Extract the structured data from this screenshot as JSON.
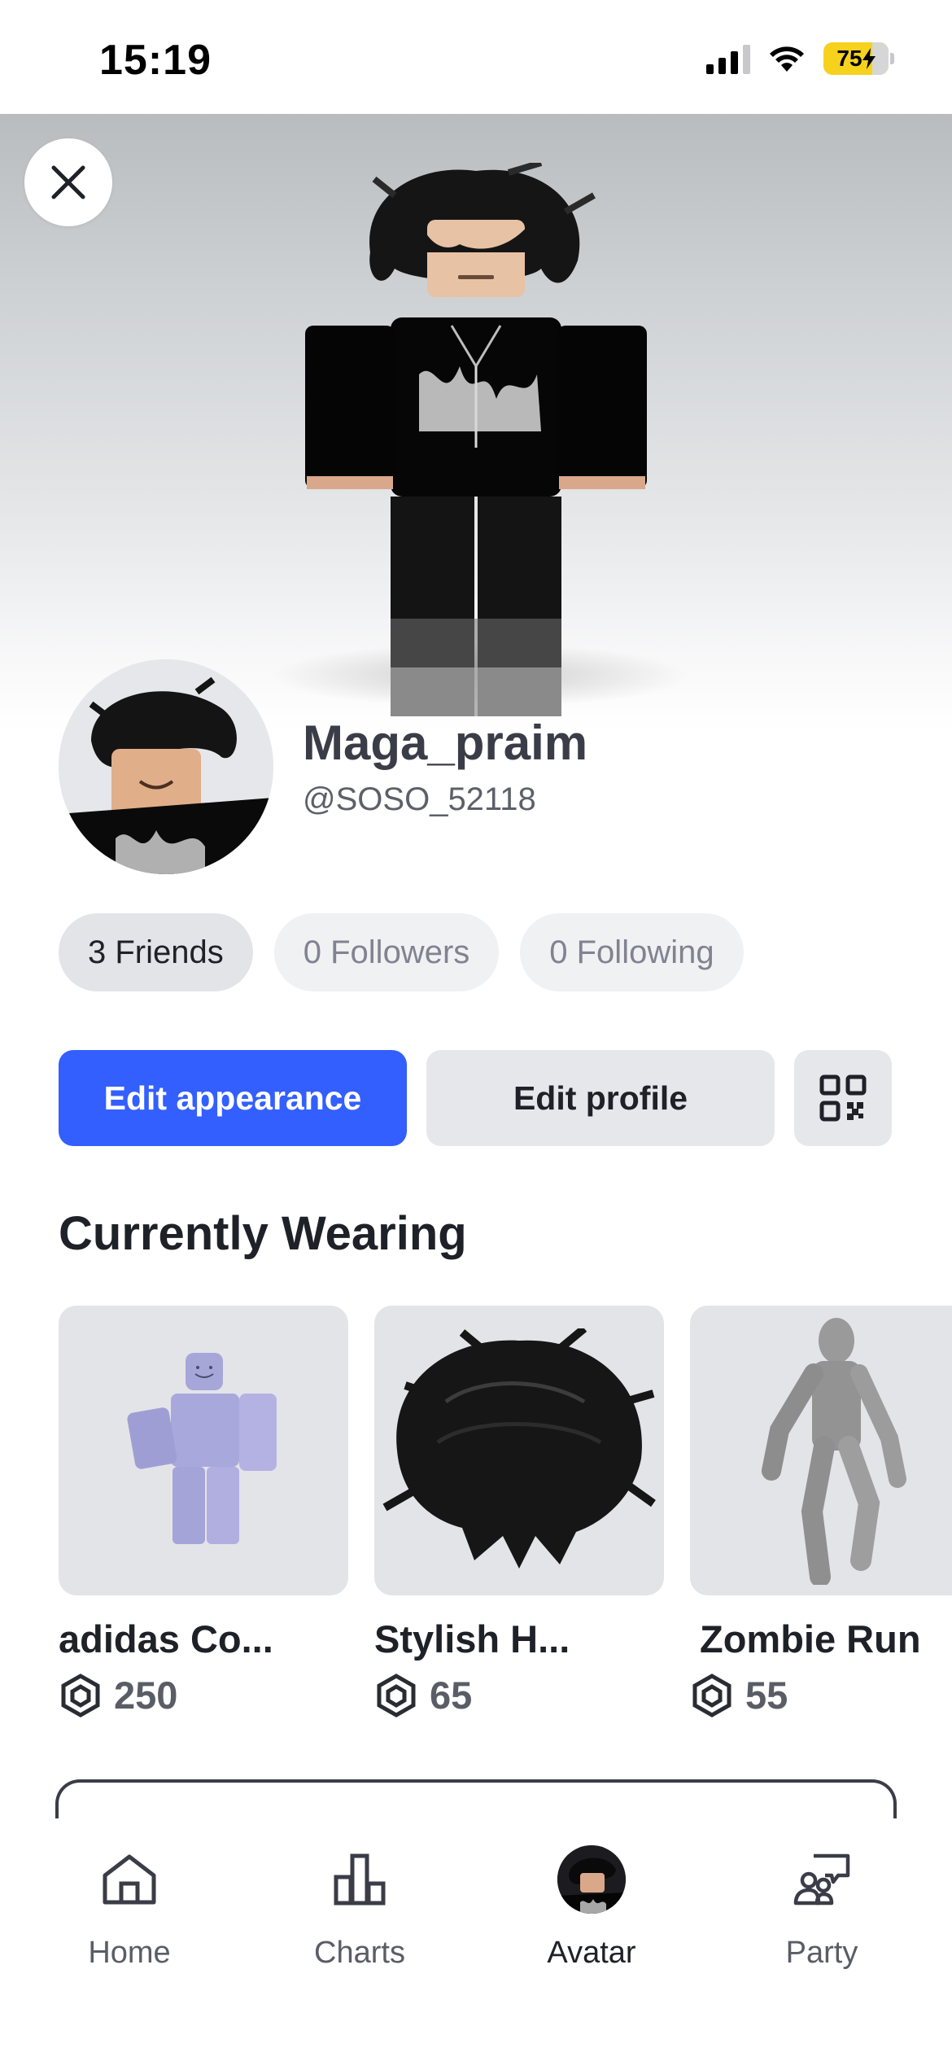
{
  "status_bar": {
    "time": "15:19",
    "battery": "75"
  },
  "profile": {
    "display_name": "Maga_praim",
    "username": "@SOSO_52118"
  },
  "stats": {
    "friends": "3 Friends",
    "followers": "0 Followers",
    "following": "0 Following"
  },
  "actions": {
    "edit_appearance": "Edit appearance",
    "edit_profile": "Edit profile"
  },
  "currently_wearing": {
    "title": "Currently Wearing",
    "items": [
      {
        "name": "adidas Co...",
        "price": "250",
        "icon": "bundle-figure"
      },
      {
        "name": "Stylish H...",
        "price": "65",
        "icon": "hair-accessory"
      },
      {
        "name": "Zombie Run",
        "price": "55",
        "icon": "animation-figure"
      }
    ]
  },
  "nav": {
    "items": [
      {
        "label": "Home",
        "icon": "home-icon"
      },
      {
        "label": "Charts",
        "icon": "charts-icon"
      },
      {
        "label": "Avatar",
        "icon": "avatar-thumbnail"
      },
      {
        "label": "Party",
        "icon": "party-icon"
      }
    ],
    "active": "Avatar"
  },
  "colors": {
    "primary": "#335fff",
    "battery": "#f7d21c",
    "pill_bg": "#eceef1",
    "text_dark": "#1f2128"
  }
}
